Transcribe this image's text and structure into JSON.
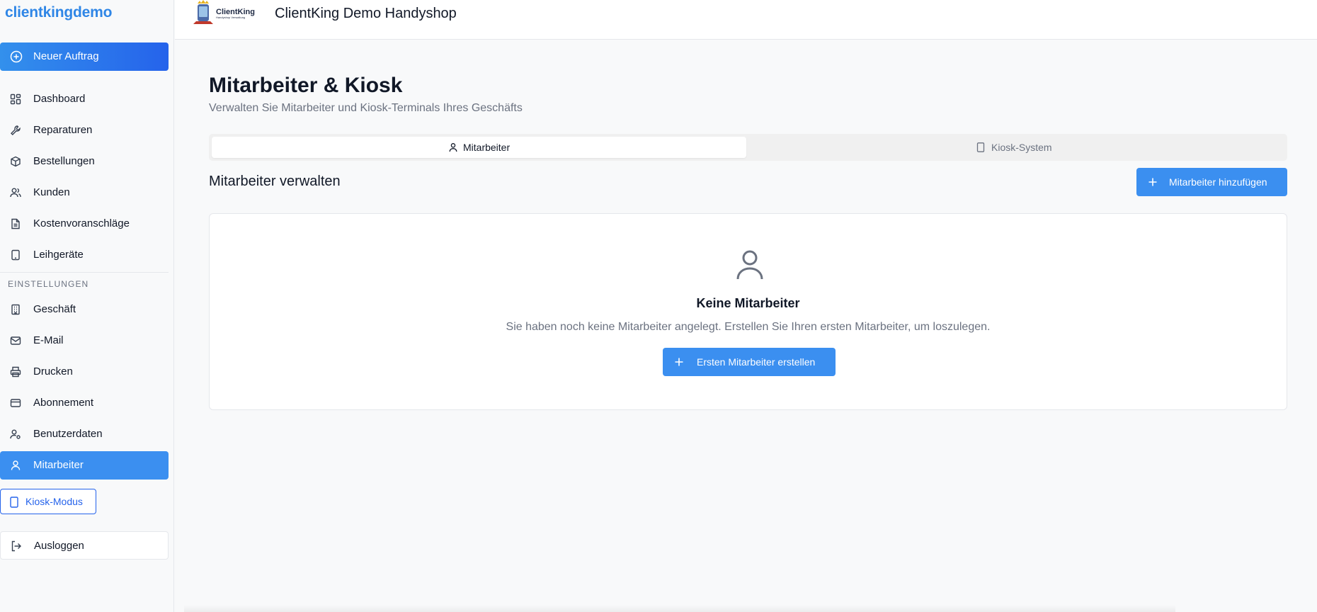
{
  "sidebar": {
    "brand": "clientkingdemo",
    "new_order": "Neuer Auftrag",
    "items": [
      {
        "label": "Dashboard",
        "icon": "dashboard-icon"
      },
      {
        "label": "Reparaturen",
        "icon": "wrench-icon"
      },
      {
        "label": "Bestellungen",
        "icon": "package-icon"
      },
      {
        "label": "Kunden",
        "icon": "users-icon"
      },
      {
        "label": "Kostenvoranschläge",
        "icon": "document-icon"
      },
      {
        "label": "Leihgeräte",
        "icon": "tablet-icon"
      }
    ],
    "settings_label": "EINSTELLUNGEN",
    "settings_items": [
      {
        "label": "Geschäft",
        "icon": "building-icon"
      },
      {
        "label": "E-Mail",
        "icon": "mail-icon"
      },
      {
        "label": "Drucken",
        "icon": "printer-icon"
      },
      {
        "label": "Abonnement",
        "icon": "credit-card-icon"
      },
      {
        "label": "Benutzerdaten",
        "icon": "user-cog-icon"
      },
      {
        "label": "Mitarbeiter",
        "icon": "user-icon",
        "active": true
      }
    ],
    "kiosk_mode": "Kiosk-Modus",
    "logout": "Ausloggen"
  },
  "header": {
    "logo_text": "ClientKing",
    "logo_subtext": "Handyshop Verwaltung",
    "shop_name": "ClientKing Demo Handyshop"
  },
  "main": {
    "title": "Mitarbeiter & Kiosk",
    "subtitle": "Verwalten Sie Mitarbeiter und Kiosk-Terminals Ihres Geschäfts",
    "tabs": [
      {
        "label": "Mitarbeiter",
        "icon": "user-icon",
        "active": true
      },
      {
        "label": "Kiosk-System",
        "icon": "tablet-icon",
        "active": false
      }
    ],
    "section_title": "Mitarbeiter verwalten",
    "add_button": "Mitarbeiter hinzufügen",
    "empty": {
      "title": "Keine Mitarbeiter",
      "text": "Sie haben noch keine Mitarbeiter angelegt. Erstellen Sie Ihren ersten Mitarbeiter, um loszulegen.",
      "button": "Ersten Mitarbeiter erstellen"
    }
  },
  "colors": {
    "accent": "#3b8ff0",
    "brand": "#2f86e6",
    "link": "#2563eb"
  }
}
